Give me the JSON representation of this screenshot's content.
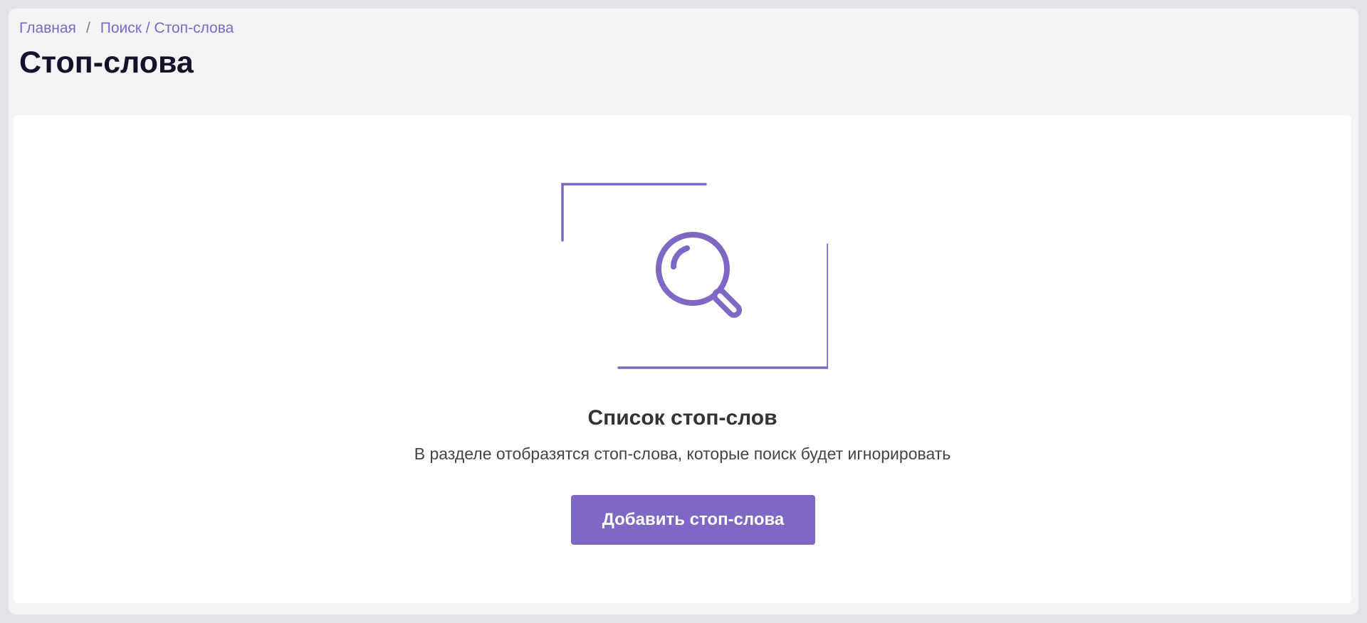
{
  "breadcrumb": {
    "items": [
      "Главная",
      "Поиск / Стоп-слова"
    ],
    "separator": "/"
  },
  "page": {
    "title": "Стоп-слова"
  },
  "empty_state": {
    "icon": "magnifier-icon",
    "title": "Список стоп-слов",
    "description": "В разделе отобразятся стоп-слова, которые поиск будет игнорировать",
    "button_label": "Добавить стоп-слова"
  },
  "colors": {
    "accent": "#7e68c4",
    "link": "#7c69c7",
    "title": "#16112a",
    "page_bg": "#f4f4f7",
    "card_bg": "#ffffff"
  }
}
